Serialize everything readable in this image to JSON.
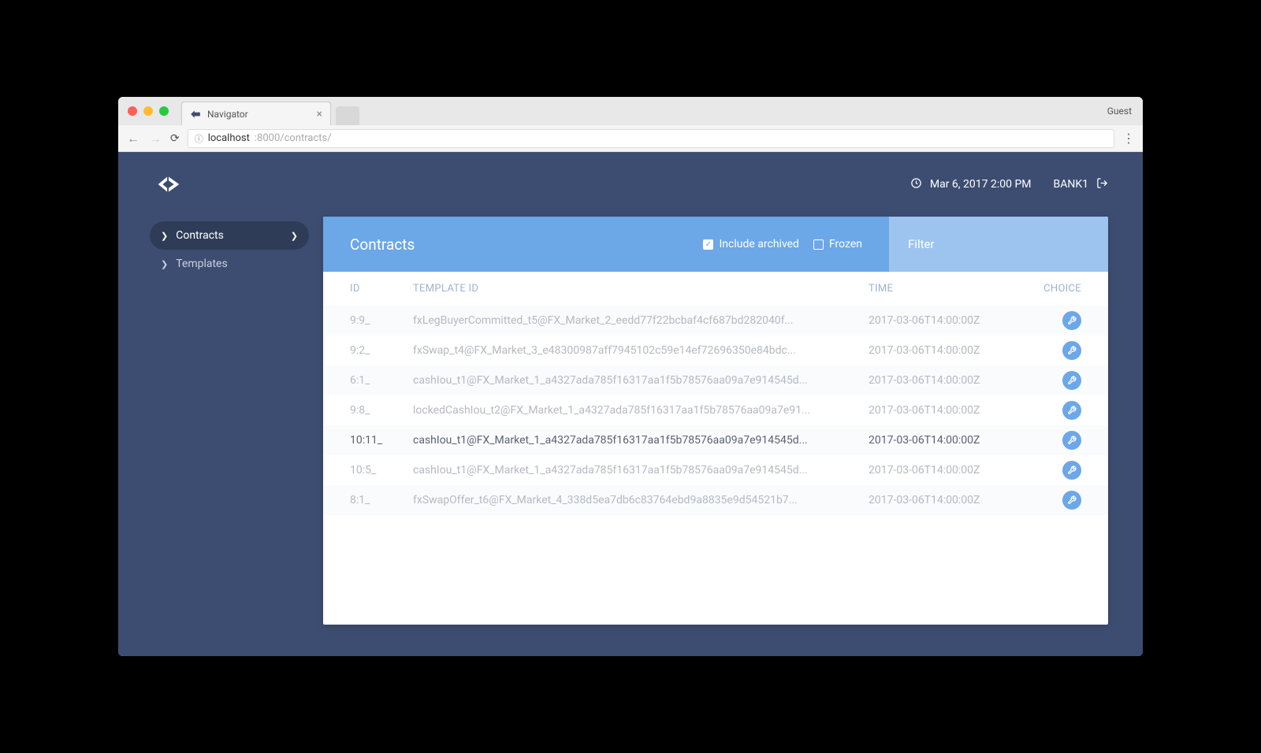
{
  "browser": {
    "tab_title": "Navigator",
    "guest": "Guest",
    "url_host": "localhost",
    "url_port_path": ":8000/contracts/"
  },
  "header": {
    "datetime": "Mar 6, 2017 2:00 PM",
    "user": "BANK1"
  },
  "sidebar": {
    "items": [
      {
        "label": "Contracts",
        "active": true
      },
      {
        "label": "Templates",
        "active": false
      }
    ]
  },
  "toolbar": {
    "title": "Contracts",
    "include_archived_label": "Include archived",
    "include_archived_checked": true,
    "frozen_label": "Frozen",
    "frozen_checked": false,
    "filter_placeholder": "Filter"
  },
  "table": {
    "headers": {
      "id": "ID",
      "template": "TEMPLATE ID",
      "time": "TIME",
      "choice": "CHOICE"
    },
    "rows": [
      {
        "id": "9:9_",
        "template": "fxLegBuyerCommitted_t5@FX_Market_2_eedd77f22bcbaf4cf687bd282040f...",
        "time": "2017-03-06T14:00:00Z",
        "highlight": false
      },
      {
        "id": "9:2_",
        "template": "fxSwap_t4@FX_Market_3_e48300987aff7945102c59e14ef72696350e84bdc...",
        "time": "2017-03-06T14:00:00Z",
        "highlight": false
      },
      {
        "id": "6:1_",
        "template": "cashIou_t1@FX_Market_1_a4327ada785f16317aa1f5b78576aa09a7e914545d...",
        "time": "2017-03-06T14:00:00Z",
        "highlight": false
      },
      {
        "id": "9:8_",
        "template": "lockedCashIou_t2@FX_Market_1_a4327ada785f16317aa1f5b78576aa09a7e91...",
        "time": "2017-03-06T14:00:00Z",
        "highlight": false
      },
      {
        "id": "10:11_",
        "template": "cashIou_t1@FX_Market_1_a4327ada785f16317aa1f5b78576aa09a7e914545d...",
        "time": "2017-03-06T14:00:00Z",
        "highlight": true
      },
      {
        "id": "10:5_",
        "template": "cashIou_t1@FX_Market_1_a4327ada785f16317aa1f5b78576aa09a7e914545d...",
        "time": "2017-03-06T14:00:00Z",
        "highlight": false
      },
      {
        "id": "8:1_",
        "template": "fxSwapOffer_t6@FX_Market_4_338d5ea7db6c83764ebd9a8835e9d54521b7...",
        "time": "2017-03-06T14:00:00Z",
        "highlight": false
      }
    ]
  }
}
